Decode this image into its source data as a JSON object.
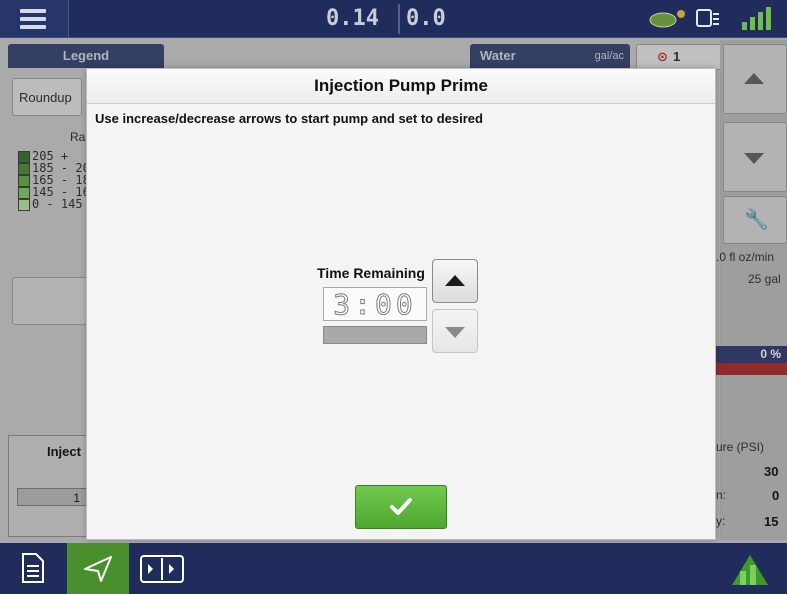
{
  "topbar": {
    "value_left": "0.14",
    "value_right": "0.0",
    "icons": [
      "menu-icon",
      "seed-tube-icon",
      "display-icon",
      "gps-signal-icon"
    ]
  },
  "background": {
    "legend_tab": "Legend",
    "water_tab": "Water",
    "water_unit": "gal/ac",
    "alarm_count": "1",
    "product_button": "Roundup",
    "rate_label": "Ra",
    "legend_ranges": [
      {
        "label": "205 +",
        "color": "#2e6a1f"
      },
      {
        "label": "185 - 20",
        "color": "#3f8a2a"
      },
      {
        "label": "165 - 18",
        "color": "#55a83a"
      },
      {
        "label": "145 - 16",
        "color": "#7cc45a"
      },
      {
        "label": "0 - 145",
        "color": "#b6e39a"
      }
    ],
    "rate_readout": ".0 fl oz/min",
    "volume_readout": "25 gal",
    "percent": "0 %",
    "pressure_label": "ure (PSI)",
    "pressure_value": "30",
    "min_label": "n:",
    "min_value": "0",
    "max_label": "y:",
    "max_value": "15",
    "inject_label": "Inject",
    "inject_value": "1"
  },
  "modal": {
    "title": "Injection Pump Prime",
    "instruction": "Use increase/decrease arrows to start pump and set to desired",
    "time_label": "Time Remaining",
    "time_value": "3:00",
    "progress": 0,
    "ok_icon": "checkmark-icon"
  },
  "colors": {
    "nav_blue": "#1f2c5c",
    "ok_green": "#5cb63a"
  }
}
